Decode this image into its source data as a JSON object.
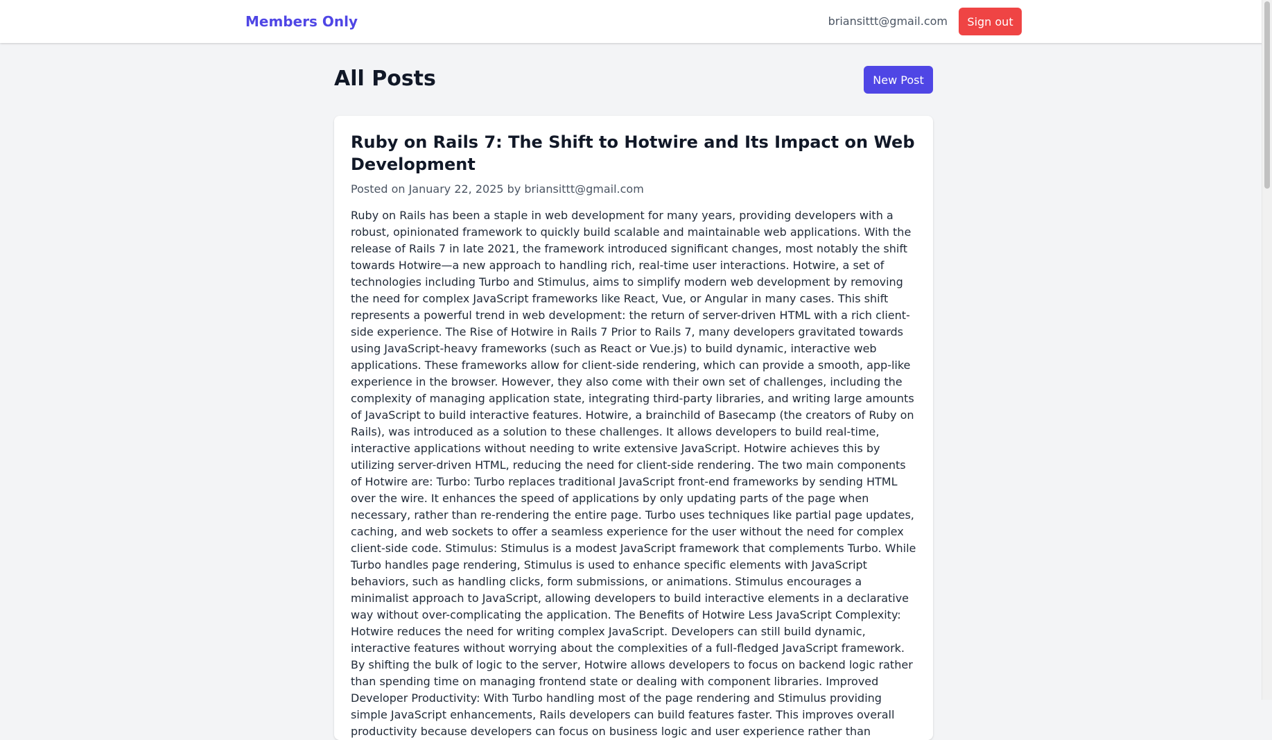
{
  "navbar": {
    "brand": "Members Only",
    "user_email": "briansittt@gmail.com",
    "signout_label": "Sign out"
  },
  "main": {
    "title": "All Posts",
    "new_post_label": "New Post"
  },
  "posts": [
    {
      "title": "Ruby on Rails 7: The Shift to Hotwire and Its Impact on Web Development",
      "meta": "Posted on January 22, 2025 by briansittt@gmail.com",
      "body": "Ruby on Rails has been a staple in web development for many years, providing developers with a robust, opinionated framework to quickly build scalable and maintainable web applications. With the release of Rails 7 in late 2021, the framework introduced significant changes, most notably the shift towards Hotwire—a new approach to handling rich, real-time user interactions. Hotwire, a set of technologies including Turbo and Stimulus, aims to simplify modern web development by removing the need for complex JavaScript frameworks like React, Vue, or Angular in many cases. This shift represents a powerful trend in web development: the return of server-driven HTML with a rich client-side experience. The Rise of Hotwire in Rails 7 Prior to Rails 7, many developers gravitated towards using JavaScript-heavy frameworks (such as React or Vue.js) to build dynamic, interactive web applications. These frameworks allow for client-side rendering, which can provide a smooth, app-like experience in the browser. However, they also come with their own set of challenges, including the complexity of managing application state, integrating third-party libraries, and writing large amounts of JavaScript to build interactive features. Hotwire, a brainchild of Basecamp (the creators of Ruby on Rails), was introduced as a solution to these challenges. It allows developers to build real-time, interactive applications without needing to write extensive JavaScript. Hotwire achieves this by utilizing server-driven HTML, reducing the need for client-side rendering. The two main components of Hotwire are: Turbo: Turbo replaces traditional JavaScript front-end frameworks by sending HTML over the wire. It enhances the speed of applications by only updating parts of the page when necessary, rather than re-rendering the entire page. Turbo uses techniques like partial page updates, caching, and web sockets to offer a seamless experience for the user without the need for complex client-side code. Stimulus: Stimulus is a modest JavaScript framework that complements Turbo. While Turbo handles page rendering, Stimulus is used to enhance specific elements with JavaScript behaviors, such as handling clicks, form submissions, or animations. Stimulus encourages a minimalist approach to JavaScript, allowing developers to build interactive elements in a declarative way without over-complicating the application. The Benefits of Hotwire Less JavaScript Complexity: Hotwire reduces the need for writing complex JavaScript. Developers can still build dynamic, interactive features without worrying about the complexities of a full-fledged JavaScript framework. By shifting the bulk of logic to the server, Hotwire allows developers to focus on backend logic rather than spending time on managing frontend state or dealing with component libraries. Improved Developer Productivity: With Turbo handling most of the page rendering and Stimulus providing simple JavaScript enhancements, Rails developers can build features faster. This improves overall productivity because developers can focus on business logic and user experience rather than managing application state across a decoupled client-server architecture. Faster Performance: Since Turbo only replaces the necessary parts of a page, it results in faster page loads and less data"
    }
  ],
  "colors": {
    "brand": "#4f46e5",
    "primary_button": "#4f46e5",
    "danger_button": "#ef4444",
    "page_background": "#f3f4f6"
  }
}
